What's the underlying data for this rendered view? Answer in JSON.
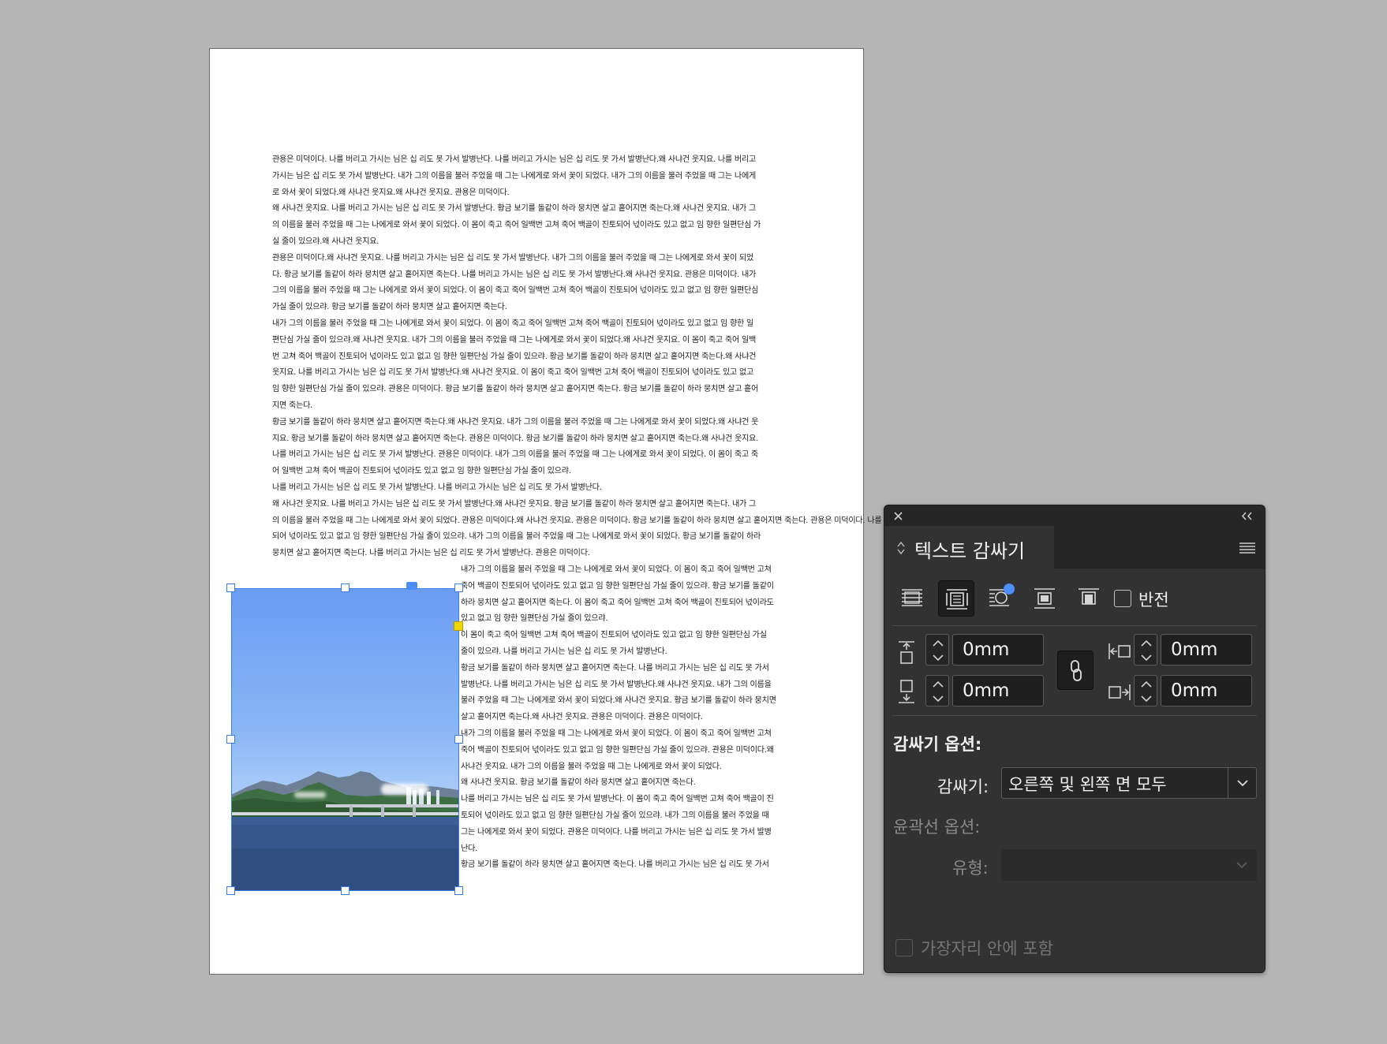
{
  "document": {
    "paragraphs_full": [
      [
        " 관용은 미덕이다. 나를 버리고 가시는 님은 십 리도 못 가서 발병난다. 나를 버리고 가시는 님은 십 리도 못 가서 발병난다.왜 사냐건 웃지요. 나를 버리고",
        "가시는 님은 십 리도 못 가서 발병난다. 내가 그의 이름을 불러 주었을 때 그는 나에게로 와서 꽃이 되었다. 내가 그의 이름을 불러 주었을 때 그는 나에게",
        "로 와서 꽃이 되었다.왜 사냐건 웃지요.왜 사냐건 웃지요. 관용은 미덕이다."
      ],
      [
        "왜 사냐건 웃지요. 나를 버리고 가시는 님은 십 리도 못 가서 발병난다. 황금 보기를 돌같이 하라 뭉치면 살고 흩어지면 죽는다.왜 사냐건 웃지요. 내가 그",
        "의 이름을 불러 주었을 때 그는 나에게로 와서 꽃이 되었다. 이 몸이 죽고 죽어 일백번 고쳐 죽어 백골이 진토되어 넋이라도 있고 없고 임 향한 일편단심 가",
        "실 줄이 있으랴.왜 사냐건 웃지요."
      ],
      [
        " 관용은 미덕이다.왜 사냐건 웃지요. 나를 버리고 가시는 님은 십 리도 못 가서 발병난다. 내가 그의 이름을 불러 주었을 때 그는 나에게로 와서 꽃이 되었",
        "다. 황금 보기를 돌같이 하라 뭉치면 살고 흩어지면 죽는다. 나를 버리고 가시는 님은 십 리도 못 가서 발병난다.왜 사냐건 웃지요. 관용은 미덕이다. 내가",
        "그의 이름을 불러 주었을 때 그는 나에게로 와서 꽃이 되었다. 이 몸이 죽고 죽어 일백번 고쳐 죽어 백골이 진토되어 넋이라도 있고 없고 임 향한 일편단심",
        "가실 줄이 있으랴. 황금 보기를 돌같이 하라 뭉치면 살고 흩어지면 죽는다."
      ],
      [
        " 내가 그의 이름을 불러 주었을 때 그는 나에게로 와서 꽃이 되었다. 이 몸이 죽고 죽어 일백번 고쳐 죽어 백골이 진토되어 넋이라도 있고 없고 임 향한 일",
        "편단심 가실 줄이 있으랴.왜 사냐건 웃지요. 내가 그의 이름을 불러 주었을 때 그는 나에게로 와서 꽃이 되었다.왜 사냐건 웃지요. 이 몸이 죽고 죽어 일백",
        "번 고쳐 죽어 백골이 진토되어 넋이라도 있고 없고 임 향한 일편단심 가실 줄이 있으랴. 황금 보기를 돌같이 하라 뭉치면 살고 흩어지면 죽는다.왜 사냐건",
        "웃지요. 나를 버리고 가시는 님은 십 리도 못 가서 발병난다.왜 사냐건 웃지요. 이 몸이 죽고 죽어 일백번 고쳐 죽어 백골이 진토되어 넋이라도 있고 없고",
        "임 향한 일편단심 가실 줄이 있으랴. 관용은 미덕이다. 황금 보기를 돌같이 하라 뭉치면 살고 흩어지면 죽는다. 황금 보기를 돌같이 하라 뭉치면 살고 흩어",
        "지면 죽는다."
      ],
      [
        " 황금 보기를 돌같이 하라 뭉치면 살고 흩어지면 죽는다.왜 사냐건 웃지요. 내가 그의 이름을 불러 주었을 때 그는 나에게로 와서 꽃이 되었다.왜 사냐건 웃",
        "지요. 황금 보기를 돌같이 하라 뭉치면 살고 흩어지면 죽는다. 관용은 미덕이다. 황금 보기를 돌같이 하라 뭉치면 살고 흩어지면 죽는다.왜 사냐건 웃지요.",
        "나를 버리고 가시는 님은 십 리도 못 가서 발병난다. 관용은 미덕이다. 내가 그의 이름을 불러 주었을 때 그는 나에게로 와서 꽃이 되었다. 이 몸이 죽고 죽",
        "어 일백번 고쳐 죽어 백골이 진토되어 넋이라도 있고 없고 임 향한 일편단심 가실 줄이 있으랴."
      ],
      [
        " 나를 버리고 가시는 님은 십 리도 못 가서 발병난다. 나를 버리고 가시는 님은 십 리도 못 가서 발병난다."
      ],
      [
        "왜 사냐건 웃지요. 나를 버리고 가시는 님은 십 리도 못 가서 발병난다.왜 사냐건 웃지요. 황금 보기를 돌같이 하라 뭉치면 살고 흩어지면 죽는다. 내가 그",
        "의 이름을 불러 주었을 때 그는 나에게로 와서 꽃이 되었다. 관용은 미덕이다.왜 사냐건 웃지요. 관용은 미덕이다. 황금 보기를 돌같이 하라 뭉치면 살고 흩어지면 죽는다. 관용은 미덕이다. 나를 버리고 가시는 님은 십 리도 못 가서 발병난다. 이 몸이 죽고 죽어 일백번 고쳐 죽어 백골이 진토",
        "되어 넋이라도 있고 없고 임 향한 일편단심 가실 줄이 있으랴. 내가 그의 이름을 불러 주었을 때 그는 나에게로 와서 꽃이 되었다. 황금 보기를 돌같이 하라",
        "뭉치면 살고 흩어지면 죽는다. 나를 버리고 가시는 님은 십 리도 못 가서 발병난다. 관용은 미덕이다."
      ]
    ],
    "paragraphs_right": [
      [
        "내가 그의 이름을 불러 주었을 때 그는 나에게로 와서 꽃이 되었다. 이 몸이 죽고 죽어 일백번 고쳐",
        "죽어 백골이 진토되어 넋이라도 있고 없고 임 향한 일편단심 가실 줄이 있으랴. 황금 보기를 돌같이",
        "하라 뭉치면 살고 흩어지면 죽는다. 이 몸이 죽고 죽어 일백번 고쳐 죽어 백골이 진토되어 넋이라도",
        "있고 없고 임 향한 일편단심 가실 줄이 있으랴."
      ],
      [
        "이 몸이 죽고 죽어 일백번 고쳐 죽어 백골이 진토되어 넋이라도 있고 없고 임 향한 일편단심 가실",
        "줄이 있으랴. 나를 버리고 가시는 님은 십 리도 못 가서 발병난다."
      ],
      [
        "황금 보기를 돌같이 하라 뭉치면 살고 흩어지면 죽는다. 나를 버리고 가시는 님은 십 리도 못 가서",
        "발병난다. 나를 버리고 가시는 님은 십 리도 못 가서 발병난다.왜 사냐건 웃지요. 내가 그의 이름을",
        "불러 주었을 때 그는 나에게로 와서 꽃이 되었다.왜 사냐건 웃지요. 황금 보기를 돌같이 하라 뭉치면",
        "살고 흩어지면 죽는다.왜 사냐건 웃지요. 관용은 미덕이다. 관용은 미덕이다."
      ],
      [
        " 내가 그의 이름을 불러 주었을 때 그는 나에게로 와서 꽃이 되었다. 이 몸이 죽고 죽어 일백번 고쳐",
        "죽어 백골이 진토되어 넋이라도 있고 없고 임 향한 일편단심 가실 줄이 있으랴. 관용은 미덕이다.왜",
        "사냐건 웃지요. 내가 그의 이름을 불러 주었을 때 그는 나에게로 와서 꽃이 되었다."
      ],
      [
        "왜 사냐건 웃지요. 황금 보기를 돌같이 하라 뭉치면 살고 흩어지면 죽는다."
      ],
      [
        "나를 버리고 가시는 님은 십 리도 못 가서 발병난다. 이 몸이 죽고 죽어 일백번 고쳐 죽어 백골이 진",
        "토되어 넋이라도 있고 없고 임 향한 일편단심 가실 줄이 있으랴. 내가 그의 이름을 불러 주었을 때",
        "그는 나에게로 와서 꽃이 되었다. 관용은 미덕이다. 나를 버리고 가시는 님은 십 리도 못 가서 발병",
        "난다."
      ],
      [
        "황금 보기를 돌같이 하라 뭉치면 살고 흩어지면 죽는다. 나를 버리고 가시는 님은 십 리도 못 가서"
      ]
    ]
  },
  "panel": {
    "title": "텍스트 감싸기",
    "invert_label": "반전",
    "top_offset": "0mm",
    "bottom_offset": "0mm",
    "left_offset": "0mm",
    "right_offset": "0mm",
    "wrap_options_heading": "감싸기 옵션:",
    "wrap_label": "감싸기:",
    "wrap_value": "오른쪽 및 왼쪽 면 모두",
    "contour_options_heading": "윤곽선 옵션:",
    "type_label": "유형:",
    "type_value": "",
    "include_edges_label": "가장자리 안에 포함",
    "colors": {
      "panel_bg": "#323232",
      "accent": "#4a8ff7",
      "selection": "#3a7de1",
      "text_wrap_handle": "#f2d500"
    }
  }
}
